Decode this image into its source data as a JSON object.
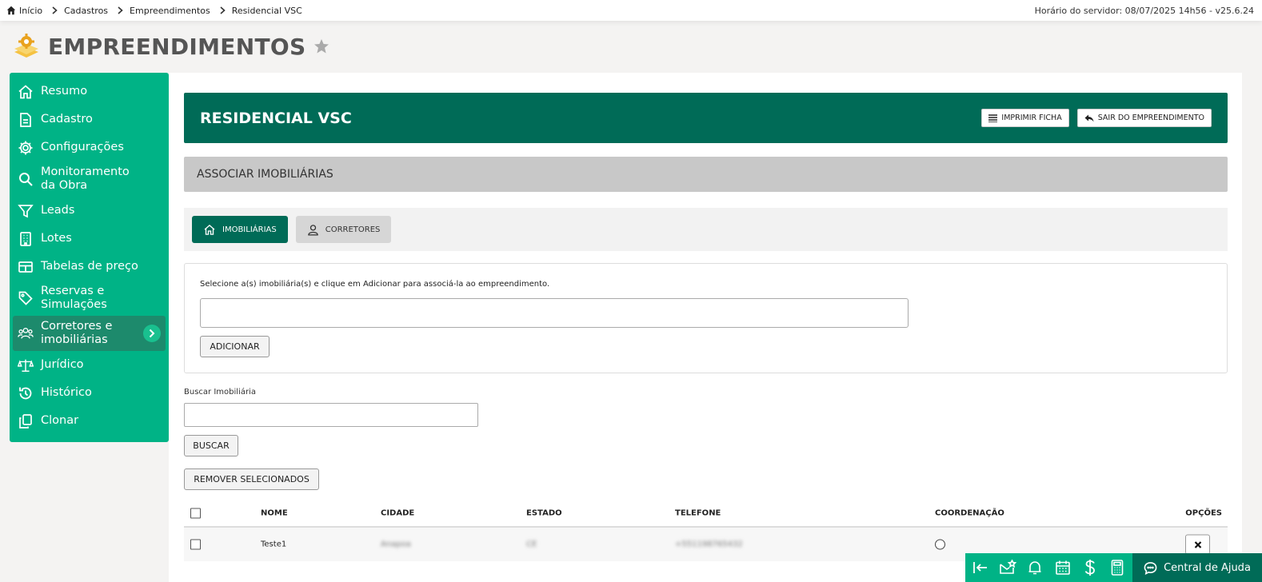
{
  "breadcrumb": [
    "Início",
    "Cadastros",
    "Empreendimentos",
    "Residencial VSC"
  ],
  "server_info": "Horário do servidor: 08/07/2025 14h56 - v25.6.24",
  "page_title": "EMPREENDIMENTOS",
  "sidebar": {
    "items": [
      {
        "label": "Resumo",
        "icon": "home-icon"
      },
      {
        "label": "Cadastro",
        "icon": "document-icon"
      },
      {
        "label": "Configurações",
        "icon": "gear-icon"
      },
      {
        "label": "Monitoramento da Obra",
        "icon": "search-icon"
      },
      {
        "label": "Leads",
        "icon": "funnel-icon"
      },
      {
        "label": "Lotes",
        "icon": "building-icon"
      },
      {
        "label": "Tabelas de preço",
        "icon": "table-icon"
      },
      {
        "label": "Reservas e Simulações",
        "icon": "tag-icon"
      },
      {
        "label": "Corretores e imobiliárias",
        "icon": "users-icon",
        "active": true
      },
      {
        "label": "Jurídico",
        "icon": "scale-icon"
      },
      {
        "label": "Histórico",
        "icon": "history-icon"
      },
      {
        "label": "Clonar",
        "icon": "copy-icon"
      }
    ]
  },
  "header": {
    "title": "RESIDENCIAL VSC",
    "print_label": "IMPRIMIR FICHA",
    "exit_label": "SAIR DO EMPREENDIMENTO"
  },
  "section_title": "ASSOCIAR IMOBILIÁRIAS",
  "tabs": [
    {
      "label": "IMOBILIÁRIAS",
      "active": true
    },
    {
      "label": "CORRETORES",
      "active": false
    }
  ],
  "associate": {
    "instruction": "Selecione a(s) imobiliária(s) e clique em Adicionar para associá-la ao empreendimento.",
    "add_label": "ADICIONAR"
  },
  "search": {
    "label": "Buscar Imobiliária",
    "button": "BUSCAR"
  },
  "remove_label": "REMOVER SELECIONADOS",
  "table": {
    "columns": [
      "NOME",
      "CIDADE",
      "ESTADO",
      "TELEFONE",
      "COORDENAÇÃO",
      "OPÇÕES"
    ],
    "rows": [
      {
        "nome": "Teste1",
        "cidade": "Anapoa",
        "estado": "CE",
        "telefone": "+551198765432"
      }
    ]
  },
  "help_label": "Central de Ajuda",
  "colors": {
    "sidebar": "#00b386",
    "header": "#006b57",
    "accent": "#19c08f"
  }
}
